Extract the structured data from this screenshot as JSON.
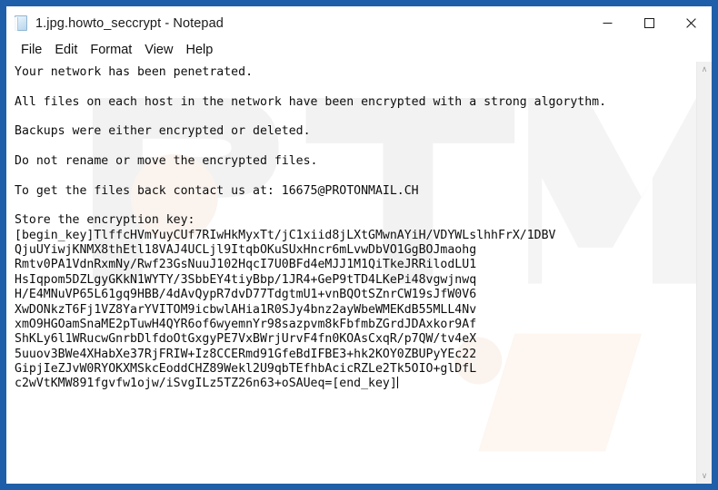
{
  "window": {
    "title": "1.jpg.howto_seccrypt - Notepad",
    "icon": "notepad-document-icon",
    "frame_color": "#1f5fa9",
    "controls": {
      "minimize": "–",
      "maximize": "□",
      "close": "✕"
    }
  },
  "menubar": {
    "items": [
      {
        "label": "File"
      },
      {
        "label": "Edit"
      },
      {
        "label": "Format"
      },
      {
        "label": "View"
      },
      {
        "label": "Help"
      }
    ]
  },
  "scrollbar": {
    "up_arrow": "∧",
    "down_arrow": "∨"
  },
  "document": {
    "contact_email": "16675@PROTONMAIL.CH",
    "key_begin_marker": "[begin_key]",
    "key_end_marker": "[end_key]",
    "body": "Your network has been penetrated.\n\nAll files on each host in the network have been encrypted with a strong algorythm.\n\nBackups were either encrypted or deleted.\n\nDo not rename or move the encrypted files.\n\nTo get the files back contact us at: 16675@PROTONMAIL.CH\n\nStore the encryption key:\n[begin_key]TlffcHVmYuyCUf7RIwHkMyxTt/jC1xiid8jLXtGMwnAYiH/VDYWLslhhFrX/1DBV\nQjuUYiwjKNMX8thEtl18VAJ4UCLjl9ItqbOKuSUxHncr6mLvwDbVO1GgBOJmaohg\nRmtv0PA1VdnRxmNy/Rwf23GsNuuJ102HqcI7U0BFd4eMJJ1M1QiTkeJRRilodLU1\nHsIqpom5DZLgyGKkN1WYTY/3SbbEY4tiyBbp/1JR4+GeP9tTD4LKePi48vgwjnwq\nH/E4MNuVP65L61gq9HBB/4dAvQypR7dvD77TdgtmU1+vnBQOtSZnrCW19sJfW0V6\nXwDONkzT6Fj1VZ8YarYVITOM9icbwlAHia1R0SJy4bnz2ayWbeWMEKdB55MLL4Nv\nxmO9HGOamSnaME2pTuwH4QYR6of6wyemnYr98sazpvm8kFbfmbZGrdJDAxkor9Af\nShKLy6l1WRucwGnrbDlfdoOtGxgyPE7VxBWrjUrvF4fn0KOAsCxqR/p7QW/tv4eX\n5uuov3BWe4XHabXe37RjFRIW+Iz8CCERmd91GfeBdIFBE3+hk2KOY0ZBUPyYEc22\nGipjIeZJvW0RYOKXMSkcEoddCHZ89Wekl2U9qbTEfhbAcicRZLe2Tk5OIO+glDfL\nc2wVtKMW891fgvfw1ojw/iSvgILz5TZ26n63+oSAUeq=[end_key]"
  }
}
